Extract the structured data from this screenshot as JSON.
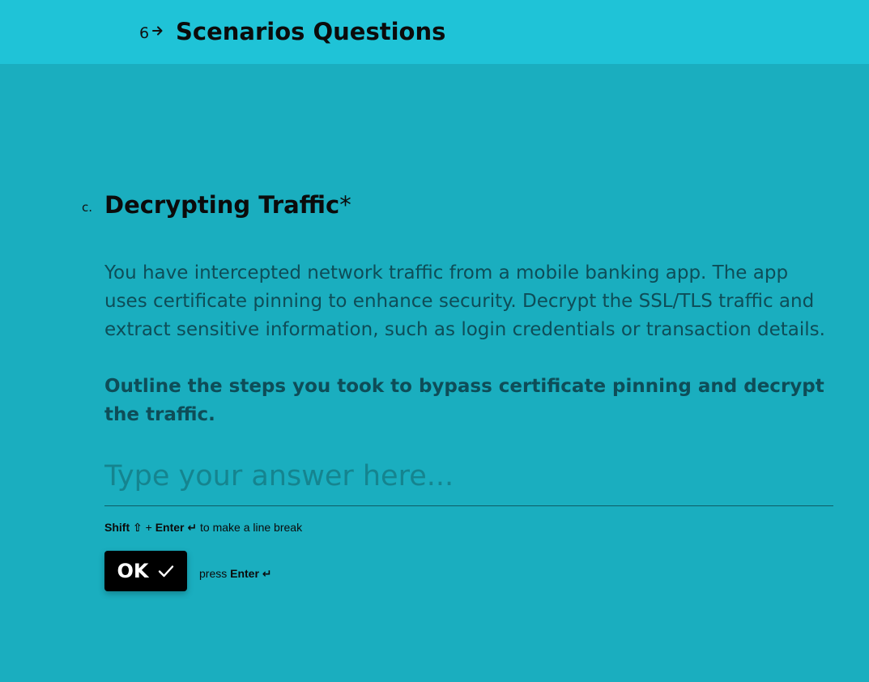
{
  "header": {
    "question_number": "6",
    "arrow_icon": "arrow-right-icon",
    "title": "Scenarios Questions"
  },
  "question": {
    "letter": "c.",
    "title": "Decrypting Traffic",
    "required_mark": "*",
    "description": "You have intercepted network traffic from a mobile banking app. The app uses certificate pinning to enhance security. Decrypt the SSL/TLS traffic and extract sensitive information, such as login credentials or transaction details.",
    "prompt": "Outline the steps you took to bypass certificate pinning and decrypt the traffic."
  },
  "answer": {
    "value": "",
    "placeholder": "Type your answer here..."
  },
  "hint": {
    "shift_label": "Shift ⇧",
    "plus": " + ",
    "enter_label": "Enter ↵",
    "suffix": " to make a line break"
  },
  "ok_button": {
    "label": "OK",
    "icon": "check-icon"
  },
  "press_hint": {
    "prefix": "press ",
    "enter_label": "Enter ↵"
  },
  "colors": {
    "background": "#1aaebf",
    "header_background": "#1fc3d7",
    "text_dark": "#0e4d58",
    "button": "#000000"
  }
}
